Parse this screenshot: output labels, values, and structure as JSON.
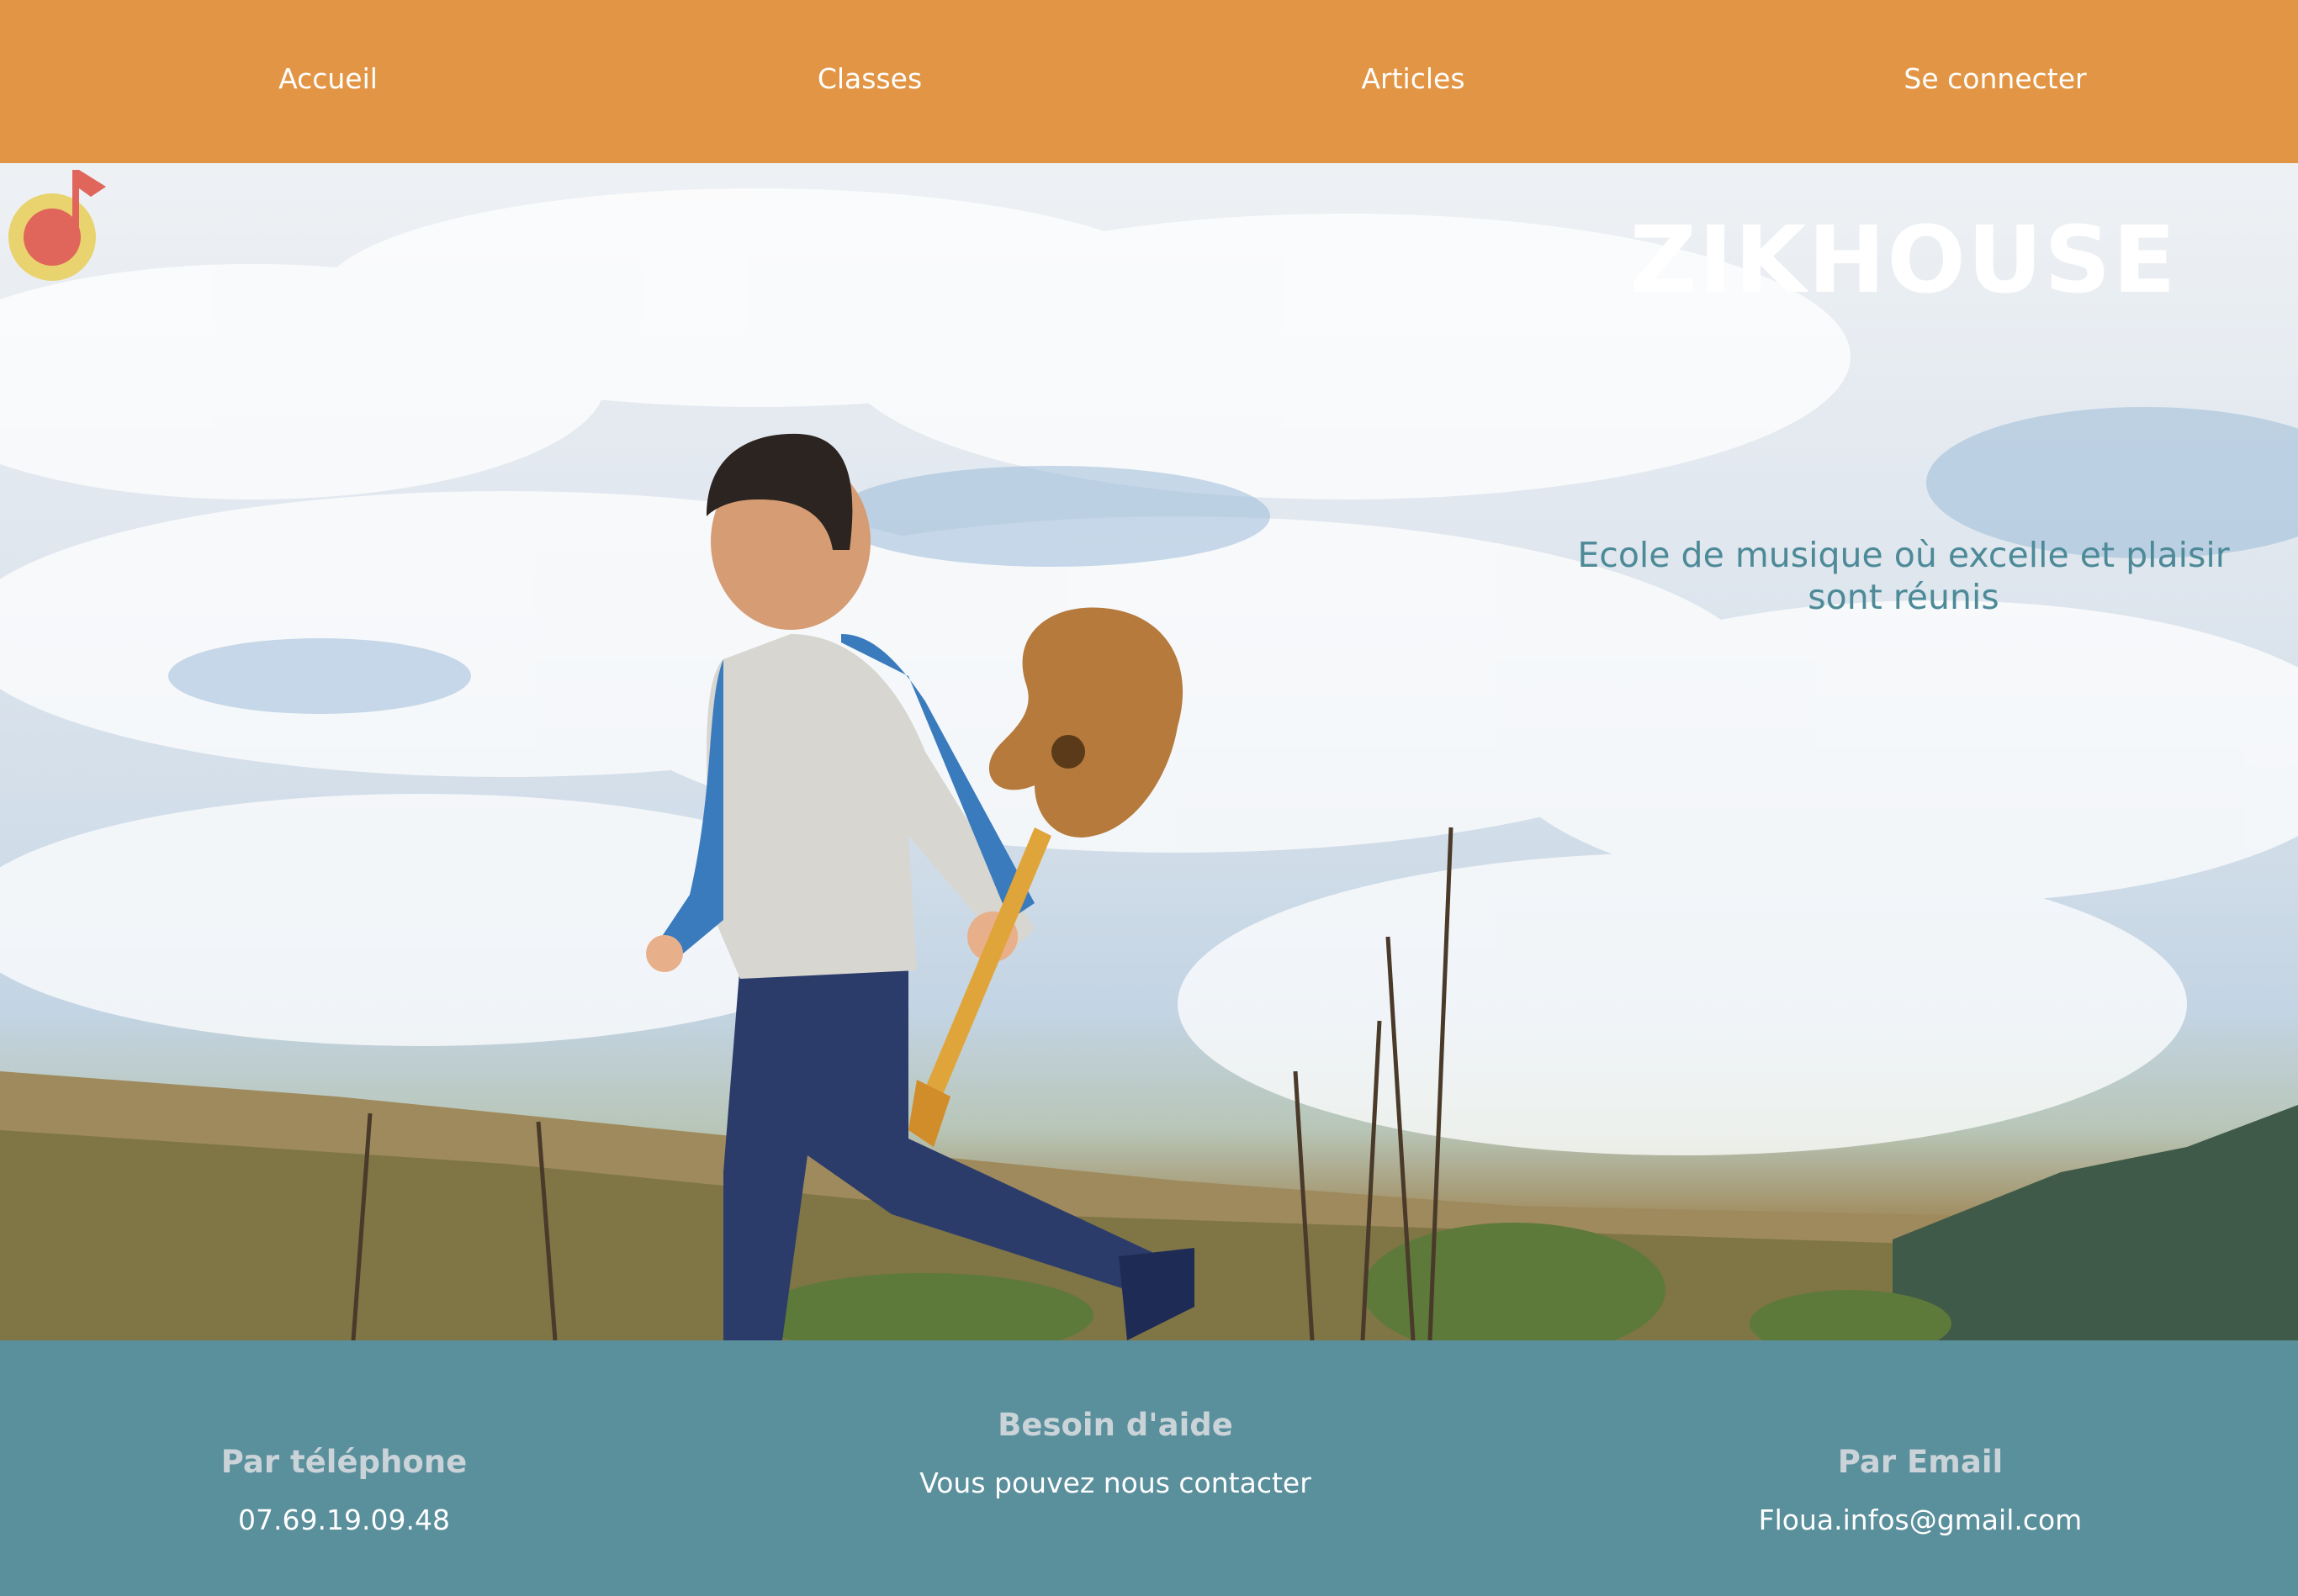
{
  "nav": {
    "home": "Accueil",
    "classes": "Classes",
    "articles": "Articles",
    "login": "Se connecter"
  },
  "hero": {
    "title": "ZIKHOUSE",
    "logo_icon": "music-note-icon",
    "tagline": "Ecole de musique où excelle et plaisir sont réunis"
  },
  "footer": {
    "phone": {
      "heading": "Par téléphone",
      "value": "07.69.19.09.48"
    },
    "help": {
      "heading": "Besoin d'aide",
      "text": "Vous pouvez nous contacter"
    },
    "email": {
      "heading": "Par Email",
      "value": "Floua.infos@gmail.com"
    }
  },
  "colors": {
    "nav_bg": "#e29645",
    "footer_bg": "#5a8f9c",
    "tagline": "#4d8a98",
    "footer_heading": "#c9d3d8"
  }
}
